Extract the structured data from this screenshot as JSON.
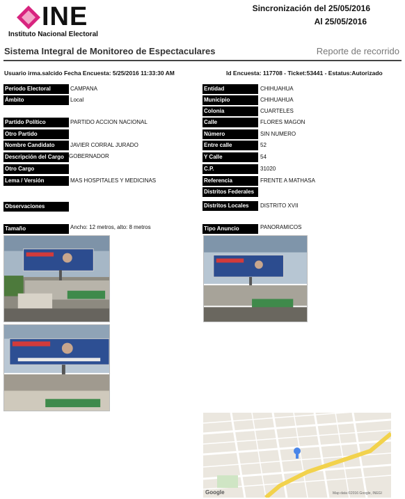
{
  "header": {
    "logo_text": "INE",
    "logo_subtitle": "Instituto Nacional Electoral",
    "sync_line1": "Sincronización del 25/05/2016",
    "sync_line2": "Al 25/05/2016",
    "system_title": "Sistema Integral de Monitoreo de Espectaculares",
    "report_link": "Reporte de recorrido"
  },
  "meta": {
    "left": "Usuario irma.salcido Fecha Encuesta: 5/25/2016 11:33:30 AM",
    "right": "Id Encuesta: 117708 - Ticket:53441 - Estatus:Autorizado"
  },
  "left_fields": [
    {
      "label": "Periodo Electoral",
      "value": "CAMPANA"
    },
    {
      "label": "Ámbito",
      "value": "Local"
    },
    {
      "label": "Partido Político",
      "value": "PARTIDO ACCION NACIONAL"
    },
    {
      "label": "Otro Partido",
      "value": ""
    },
    {
      "label": "Nombre Candidato",
      "value": "JAVIER CORRAL JURADO"
    },
    {
      "label": "Descripción del Cargo",
      "value": "GOBERNADOR"
    },
    {
      "label": "Otro Cargo",
      "value": ""
    },
    {
      "label": "Lema / Versión",
      "value": "MAS HOSPITALES Y MEDICINAS"
    },
    {
      "label": "Observaciones",
      "value": ""
    },
    {
      "label": "Tamaño",
      "value": "Ancho: 12 metros, alto: 8 metros"
    }
  ],
  "right_fields": [
    {
      "label": "Entidad",
      "value": "CHIHUAHUA"
    },
    {
      "label": "Municipio",
      "value": "CHIHUAHUA"
    },
    {
      "label": "Colonia",
      "value": "CUARTELES"
    },
    {
      "label": "Calle",
      "value": "FLORES MAGON"
    },
    {
      "label": "Número",
      "value": "SIN NUMERO"
    },
    {
      "label": "Entre calle",
      "value": "52"
    },
    {
      "label": "Y Calle",
      "value": "54"
    },
    {
      "label": "C.P.",
      "value": "31020"
    },
    {
      "label": "Referencia",
      "value": "FRENTE A MATHASA"
    },
    {
      "label": "Distritos Federales",
      "value": ""
    },
    {
      "label": "Distritos Locales",
      "value": "DISTRITO XVII"
    },
    {
      "label": "Tipo Anuncio",
      "value": "PANORAMICOS"
    }
  ],
  "map": {
    "google_label": "Google",
    "copyright": "Map data ©2016 Google, INEGI"
  },
  "colors": {
    "label_bg": "#000000",
    "logo_pink": "#d8247f",
    "map_road": "#f2d24c"
  }
}
